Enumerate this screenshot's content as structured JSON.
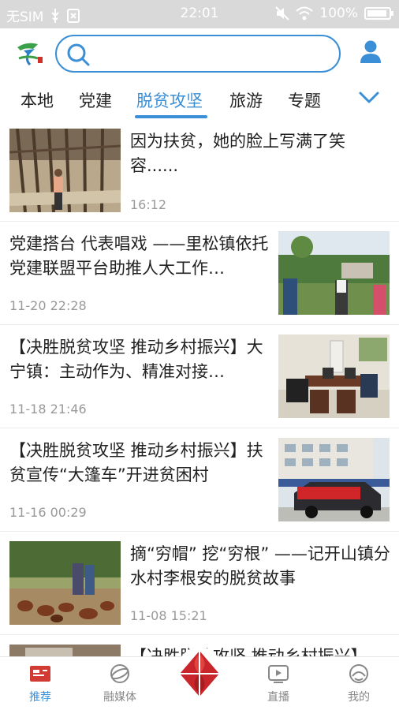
{
  "status_bar": {
    "carrier": "无SIM",
    "time": "22:01",
    "battery": "100%"
  },
  "header": {
    "search_placeholder": ""
  },
  "tabs": [
    {
      "label": "本地",
      "active": false
    },
    {
      "label": "党建",
      "active": false
    },
    {
      "label": "脱贫攻坚",
      "active": true
    },
    {
      "label": "旅游",
      "active": false
    },
    {
      "label": "专题",
      "active": false
    }
  ],
  "news": [
    {
      "title": "因为扶贫，她的脸上写满了笑容......",
      "time": "16:12",
      "image": "woman-in-front-of-wooden-house"
    },
    {
      "title": "党建搭台 代表唱戏 ——里松镇依托党建联盟平台助推人大工作…",
      "time": "11-20 22:28",
      "image": "people-talking-outdoors"
    },
    {
      "title": "【决胜脱贫攻坚 推动乡村振兴】大宁镇：主动作为、精准对接…",
      "time": "11-18 21:46",
      "image": "meeting-room"
    },
    {
      "title": "【决胜脱贫攻坚 推动乡村振兴】扶贫宣传“大篷车”开进贫困村",
      "time": "11-16 00:29",
      "image": "car-with-banner"
    },
    {
      "title": "摘“穷帽” 挖“穷根” ——记开山镇分水村李根安的脱贫故事",
      "time": "11-08 15:21",
      "image": "chickens-in-yard"
    },
    {
      "title": "【决胜脱贫攻坚 推动乡村振兴】",
      "time": "",
      "image": "partial"
    }
  ],
  "bottom_nav": [
    {
      "label": "推荐",
      "icon": "recommend-icon",
      "active": true
    },
    {
      "label": "融媒体",
      "icon": "media-globe-icon",
      "active": false
    },
    {
      "label": "",
      "icon": "center-logo-icon",
      "active": false
    },
    {
      "label": "直播",
      "icon": "live-play-icon",
      "active": false
    },
    {
      "label": "我的",
      "icon": "profile-face-icon",
      "active": false
    }
  ],
  "colors": {
    "accent": "#3a8fd6",
    "center_button": "#c8262a",
    "status_bar": "#d9d9d9"
  }
}
